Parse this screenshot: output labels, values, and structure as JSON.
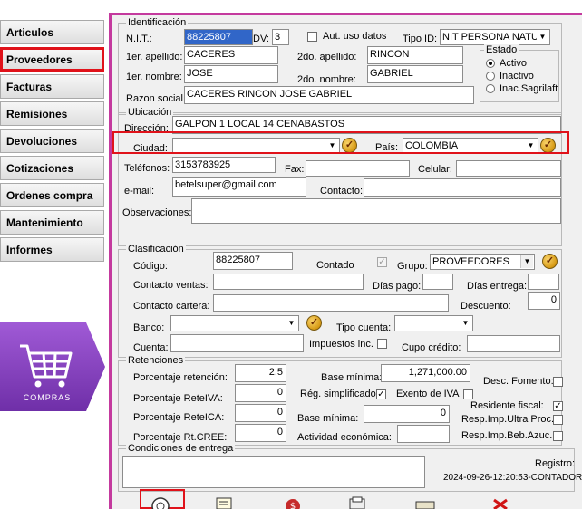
{
  "menu": [
    "Articulos",
    "Proveedores",
    "Facturas",
    "Remisiones",
    "Devoluciones",
    "Cotizaciones",
    "Ordenes compra",
    "Mantenimiento",
    "Informes"
  ],
  "compras_label": "COMPRAS",
  "identificacion": {
    "title": "Identificación",
    "nit_label": "N.I.T.:",
    "nit": "88225807",
    "dv_label": "DV:",
    "dv": "3",
    "aut_label": "Aut. uso datos",
    "tipoid_label": "Tipo ID:",
    "tipoid": "NIT PERSONA NATU",
    "apellido1_label": "1er. apellido:",
    "apellido1": "CACERES",
    "apellido2_label": "2do. apellido:",
    "apellido2": "RINCON",
    "nombre1_label": "1er. nombre:",
    "nombre1": "JOSE",
    "nombre2_label": "2do. nombre:",
    "nombre2": "GABRIEL",
    "razon_label": "Razon social:",
    "razon": "CACERES RINCON JOSE GABRIEL",
    "estado_title": "Estado",
    "estado_options": [
      "Activo",
      "Inactivo",
      "Inac.Sagrilaft"
    ]
  },
  "ubicacion": {
    "title": "Ubicación",
    "direccion_label": "Dirección:",
    "direccion": "GALPON 1 LOCAL 14 CENABASTOS",
    "ciudad_label": "Ciudad:",
    "ciudad": "",
    "pais_label": "País:",
    "pais": "COLOMBIA",
    "telefonos_label": "Teléfonos:",
    "telefonos": "3153783925",
    "fax_label": "Fax:",
    "celular_label": "Celular:",
    "email_label": "e-mail:",
    "email": "betelsuper@gmail.com",
    "contacto_label": "Contacto:",
    "observaciones_label": "Observaciones:"
  },
  "clasificacion": {
    "title": "Clasificación",
    "codigo_label": "Código:",
    "codigo": "88225807",
    "contado_label": "Contado",
    "grupo_label": "Grupo:",
    "grupo": "PROVEEDORES",
    "contacto_ventas_label": "Contacto ventas:",
    "dias_pago_label": "Días pago:",
    "dias_entrega_label": "Días entrega:",
    "contacto_cartera_label": "Contacto cartera:",
    "descuento_label": "Descuento:",
    "descuento": "0",
    "banco_label": "Banco:",
    "tipo_cuenta_label": "Tipo cuenta:",
    "cuenta_label": "Cuenta:",
    "impuestos_label": "Impuestos inc.",
    "cupo_label": "Cupo crédito:"
  },
  "retenciones": {
    "title": "Retenciones",
    "porc_ret_label": "Porcentaje retención:",
    "porc_ret": "2.5",
    "base_min_label": "Base mínima:",
    "base_min": "1,271,000.00",
    "desc_fomento_label": "Desc. Fomento:",
    "porc_reteiva_label": "Porcentaje ReteIVA:",
    "porc_reteiva": "0",
    "reg_simpl_label": "Rég. simplificado",
    "exento_iva_label": "Exento de IVA",
    "residente_label": "Residente fiscal:",
    "porc_reteica_label": "Porcentaje ReteICA:",
    "porc_reteica": "0",
    "base_min2_label": "Base mínima:",
    "base_min2": "0",
    "resp_ultra_label": "Resp.Imp.Ultra Proc.",
    "porc_cree_label": "Porcentaje Rt.CREE:",
    "porc_cree": "0",
    "actividad_label": "Actividad económica:",
    "resp_beb_label": "Resp.Imp.Beb.Azuc."
  },
  "condiciones": {
    "title": "Condiciones de entrega",
    "registro_label": "Registro:",
    "registro": "2024-09-26-12:20:53-CONTADOR"
  },
  "colors": {
    "accent": "#c43a9e",
    "highlight": "#e0121a",
    "compras": "#8a3fc0"
  }
}
